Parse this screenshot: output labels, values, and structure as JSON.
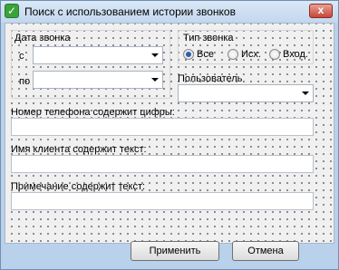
{
  "window": {
    "title": "Поиск с использованием истории звонков",
    "close_glyph": "x"
  },
  "date_group": {
    "label": "Дата звонка",
    "from_label": "с",
    "to_label": "по",
    "from_value": "",
    "to_value": ""
  },
  "call_type": {
    "label": "Тип звонка",
    "options": [
      "Все",
      "Исх.",
      "Вход."
    ],
    "selected": "Все"
  },
  "user": {
    "label": "Пользователь",
    "value": ""
  },
  "fields": {
    "phone_label": "Номер телефона содержит цифры:",
    "phone_value": "",
    "client_label": "Имя клиента содержит текст:",
    "client_value": "",
    "note_label": "Примечание содержит текст:",
    "note_value": ""
  },
  "buttons": {
    "apply": "Применить",
    "cancel": "Отмена"
  }
}
